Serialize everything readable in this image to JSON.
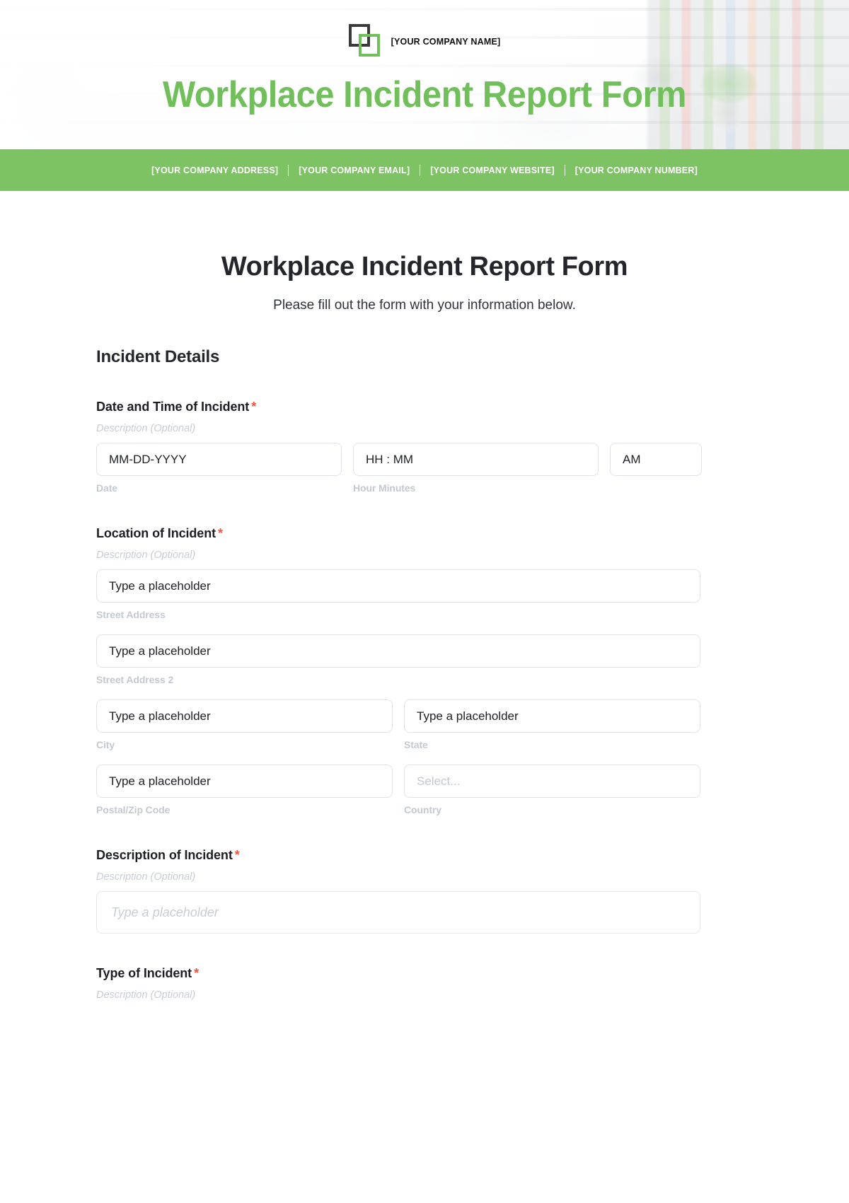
{
  "brand": {
    "company_name": "[YOUR COMPANY NAME]",
    "header_title": "Workplace Incident Report Form",
    "accent_green": "#7dc263",
    "title_green": "#70bf5a",
    "required_red": "#f2543d",
    "logo_dark": "#3a3a3a"
  },
  "contact_bar": {
    "items": [
      "[YOUR COMPANY ADDRESS]",
      "[YOUR COMPANY EMAIL]",
      "[YOUR COMPANY WEBSITE]",
      "[YOUR COMPANY NUMBER]"
    ]
  },
  "form": {
    "title": "Workplace Incident Report Form",
    "subtitle": "Please fill out the form with your information below.",
    "section_heading": "Incident Details",
    "optional_description": "Description (Optional)",
    "placeholder_text": "Type a placeholder",
    "select_placeholder": "Select...",
    "fields": {
      "datetime": {
        "label": "Date and Time of Incident",
        "required_marker": "*",
        "description": "Description (Optional)",
        "date_value": "MM-DD-YYYY",
        "date_sublabel": "Date",
        "time_value": "HH : MM",
        "time_sublabel": "Hour Minutes",
        "meridiem_value": "AM"
      },
      "location": {
        "label": "Location of Incident",
        "required_marker": "*",
        "description": "Description (Optional)",
        "street_value": "Type a placeholder",
        "street_sublabel": "Street Address",
        "street2_value": "Type a placeholder",
        "street2_sublabel": "Street Address 2",
        "city_value": "Type a placeholder",
        "city_sublabel": "City",
        "state_value": "Type a placeholder",
        "state_sublabel": "State",
        "postal_value": "Type a placeholder",
        "postal_sublabel": "Postal/Zip Code",
        "country_value": "Select...",
        "country_sublabel": "Country"
      },
      "description_of_incident": {
        "label": "Description of Incident",
        "required_marker": "*",
        "description": "Description (Optional)",
        "value": "Type a placeholder"
      },
      "type_of_incident": {
        "label": "Type of Incident",
        "required_marker": "*",
        "description": "Description (Optional)"
      }
    }
  }
}
